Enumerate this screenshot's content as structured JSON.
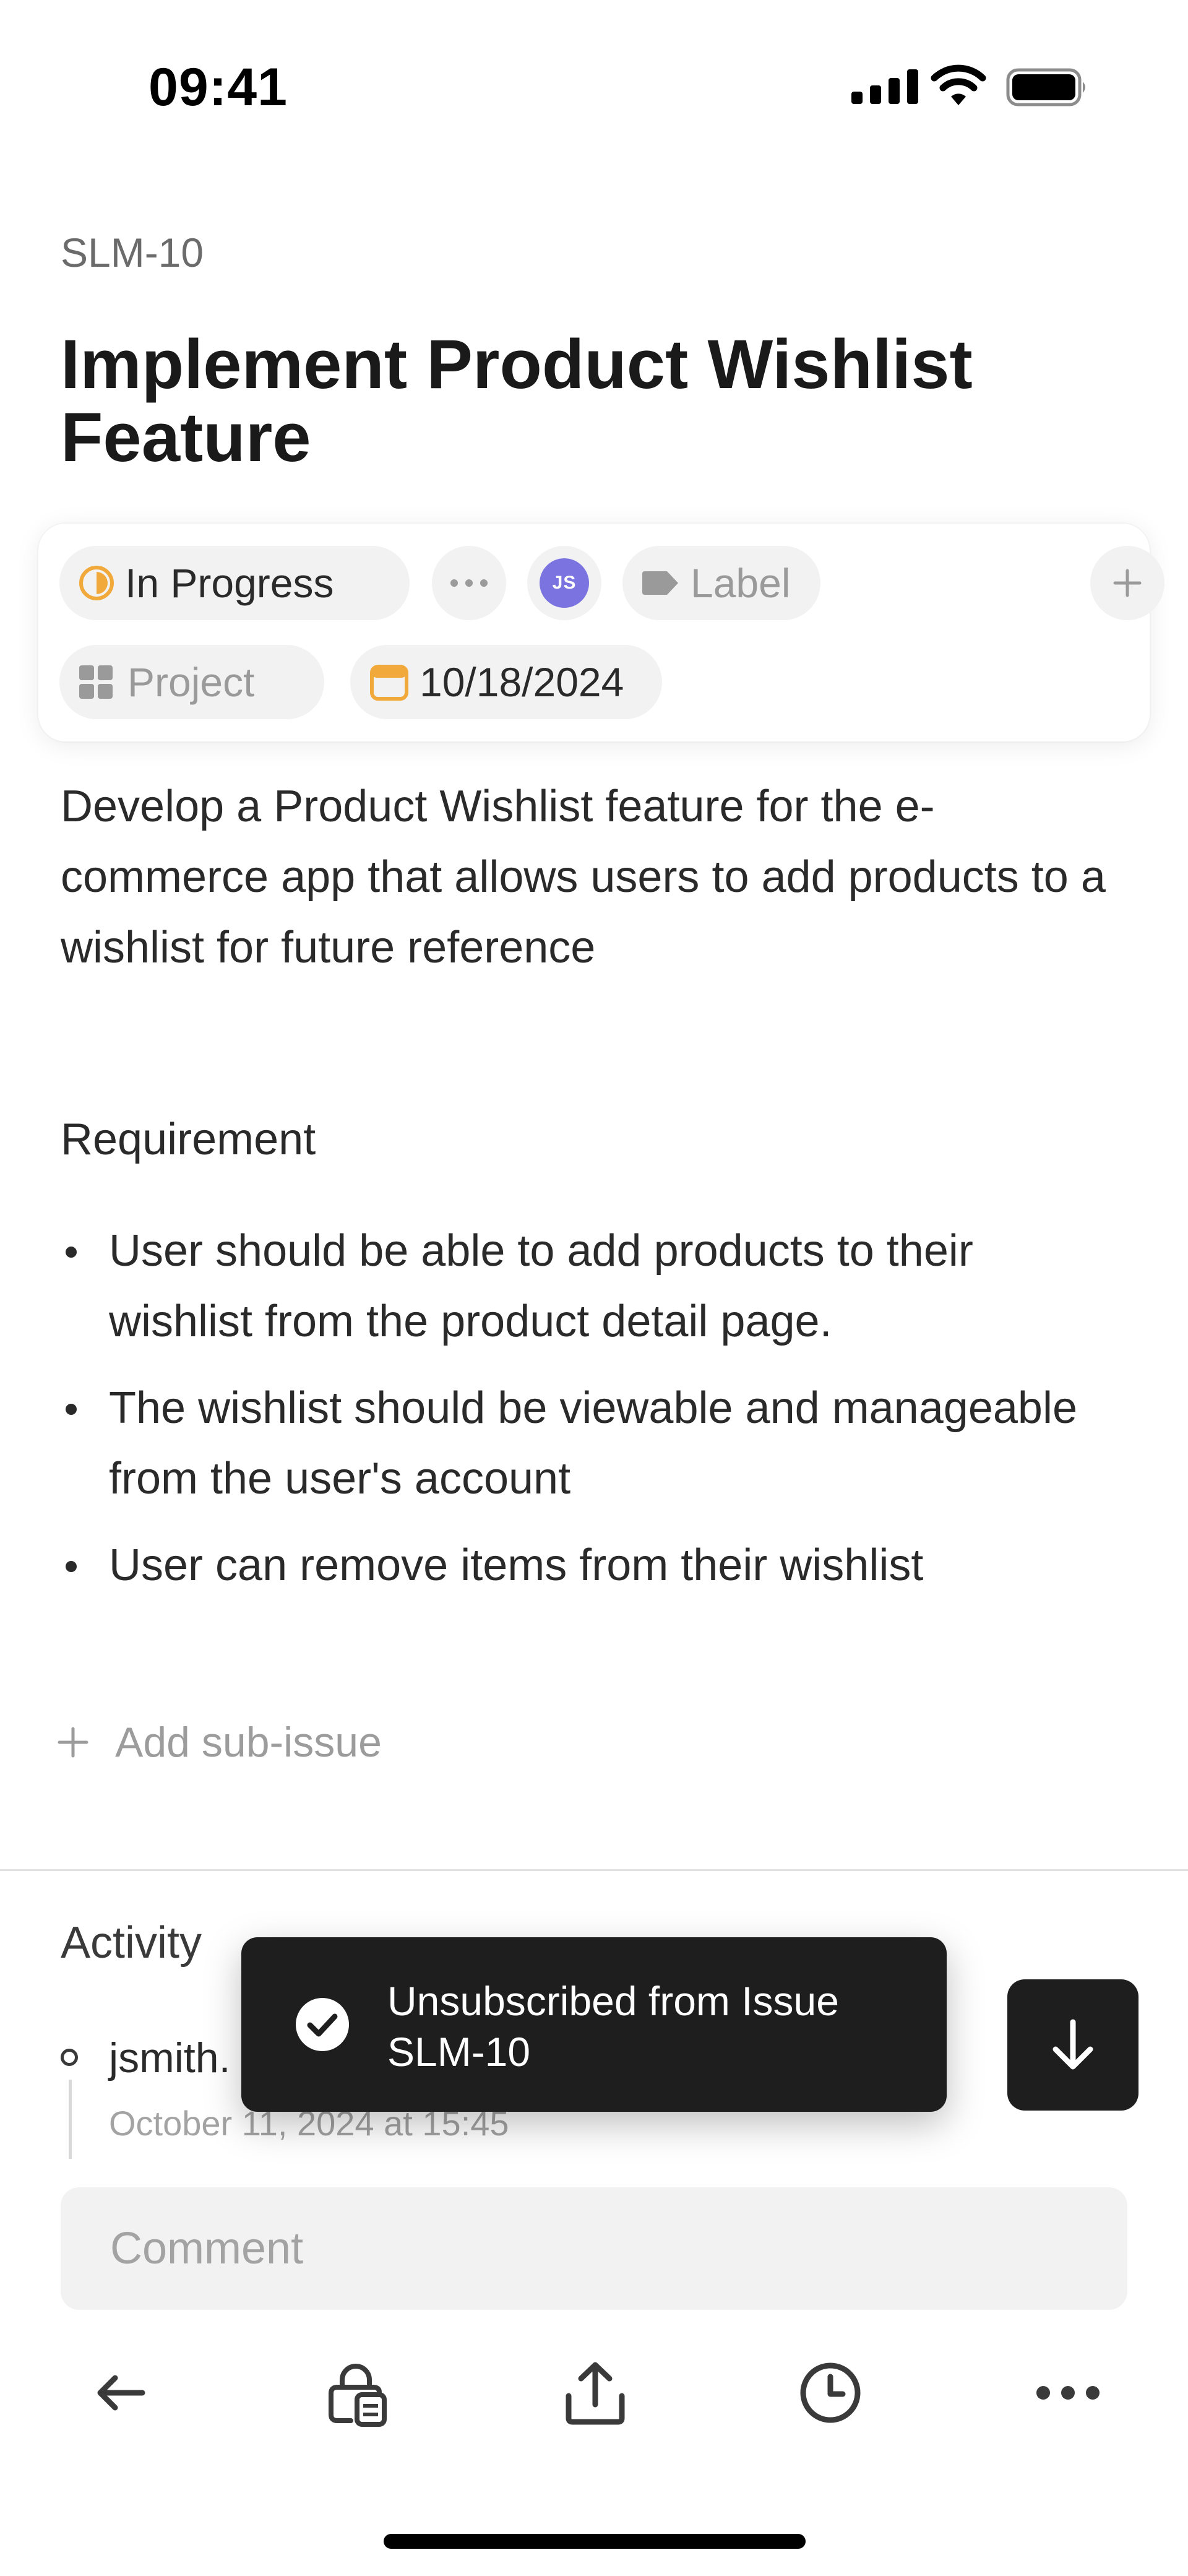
{
  "status_bar": {
    "time": "09:41"
  },
  "issue": {
    "id": "SLM-10",
    "title": "Implement Product Wishlist Feature",
    "description": "Develop a Product Wishlist feature for the e-commerce app that allows users to add products to a wishlist for future reference"
  },
  "properties": {
    "status": "In Progress",
    "assignee_initials": "JS",
    "label_placeholder": "Label",
    "project_placeholder": "Project",
    "due_date": "10/18/2024"
  },
  "requirements": {
    "heading": "Requirement",
    "items": [
      "User should be able to add products to their wishlist from the product detail page.",
      "The wishlist should be viewable and manageable from the user's account",
      "User can remove items from their wishlist"
    ]
  },
  "add_sub_issue_label": "Add sub-issue",
  "activity": {
    "heading": "Activity",
    "entries": [
      {
        "user": "jsmith.",
        "timestamp": "October 11, 2024 at 15:45"
      }
    ]
  },
  "toast": {
    "message": "Unsubscribed from Issue SLM-10"
  },
  "comment": {
    "placeholder": "Comment"
  },
  "toolbar": {
    "icons": [
      "back-arrow-icon",
      "lock-document-icon",
      "share-icon",
      "clock-icon",
      "more-icon"
    ]
  },
  "colors": {
    "status_in_progress": "#f2a93b",
    "avatar": "#7b74e0",
    "due_date_icon": "#f2a93b",
    "toast_background": "#1e1e1e"
  }
}
